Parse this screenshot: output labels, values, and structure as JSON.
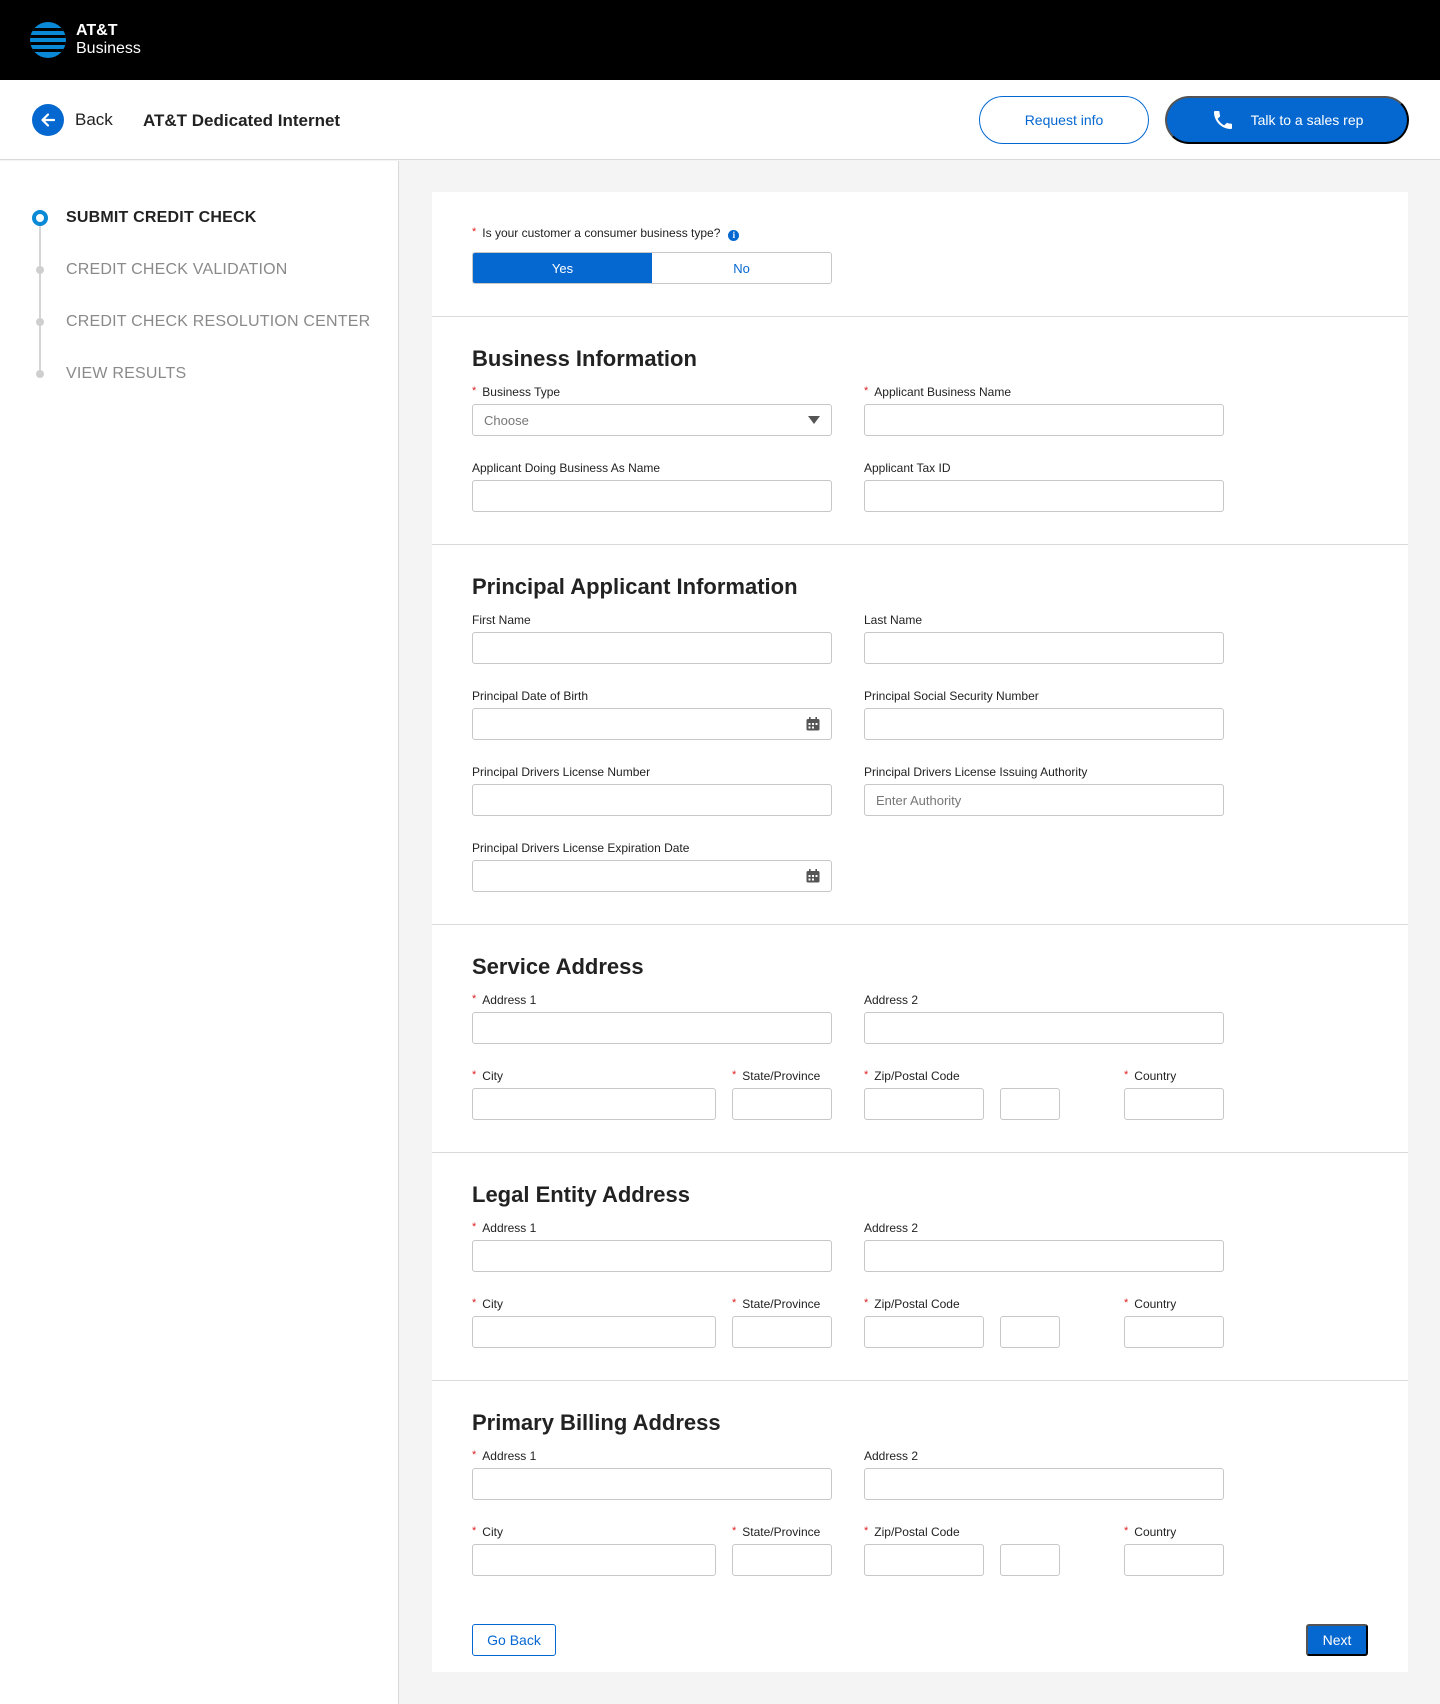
{
  "brand": {
    "line1": "AT&T",
    "line2": "Business"
  },
  "header": {
    "back_label": "Back",
    "title": "AT&T Dedicated Internet",
    "request_info": "Request info",
    "talk_to_rep": "Talk to a sales rep"
  },
  "steps": [
    {
      "label": "SUBMIT CREDIT CHECK",
      "active": true
    },
    {
      "label": "CREDIT CHECK VALIDATION",
      "active": false
    },
    {
      "label": "CREDIT CHECK RESOLUTION CENTER",
      "active": false
    },
    {
      "label": "VIEW RESULTS",
      "active": false
    }
  ],
  "consumer_question": {
    "label": "Is your customer a consumer business type?",
    "yes": "Yes",
    "no": "No",
    "selected": "Yes"
  },
  "business_info": {
    "title": "Business Information",
    "business_type_label": "Business Type",
    "business_type_value": "Choose",
    "applicant_name_label": "Applicant Business Name",
    "dba_label": "Applicant Doing Business As Name",
    "tax_id_label": "Applicant Tax ID"
  },
  "principal": {
    "title": "Principal Applicant Information",
    "first_name_label": "First Name",
    "last_name_label": "Last Name",
    "dob_label": "Principal Date of Birth",
    "ssn_label": "Principal Social Security Number",
    "license_number_label": "Principal Drivers License Number",
    "license_authority_label": "Principal Drivers License Issuing Authority",
    "license_authority_placeholder": "Enter Authority",
    "license_expiration_label": "Principal Drivers License Expiration Date"
  },
  "service_address": {
    "title": "Service Address",
    "address1": "Address 1",
    "address2": "Address 2",
    "city": "City",
    "state": "State/Province",
    "zip": "Zip/Postal Code",
    "country": "Country"
  },
  "legal_address": {
    "title": "Legal Entity Address",
    "address1": "Address 1",
    "address2": "Address 2",
    "city": "City",
    "state": "State/Province",
    "zip": "Zip/Postal Code",
    "country": "Country"
  },
  "billing_address": {
    "title": "Primary Billing Address",
    "address1": "Address 1",
    "address2": "Address 2",
    "city": "City",
    "state": "State/Province",
    "zip": "Zip/Postal Code",
    "country": "Country"
  },
  "footer": {
    "go_back": "Go Back",
    "next": "Next"
  },
  "colors": {
    "primary": "#0568d0",
    "brand_blue": "#0a8ad6",
    "required": "#e02020",
    "topbar": "#000000"
  },
  "icons": [
    "att-globe-icon",
    "arrow-left-icon",
    "phone-icon",
    "info-icon",
    "chevron-down-icon",
    "calendar-icon"
  ]
}
